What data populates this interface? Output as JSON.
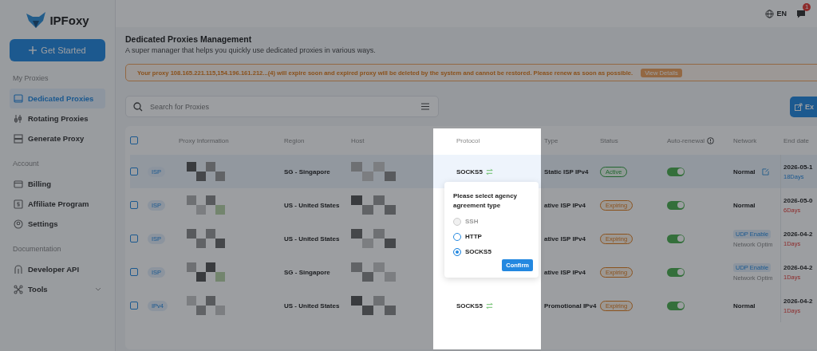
{
  "logo": {
    "name": "IPFoxy"
  },
  "sidebar": {
    "cta": "Get Started",
    "sections": [
      {
        "heading": "My Proxies",
        "items": [
          {
            "label": "Dedicated Proxies",
            "selected": true
          },
          {
            "label": "Rotating Proxies",
            "selected": false
          },
          {
            "label": "Generate Proxy",
            "selected": false
          }
        ]
      },
      {
        "heading": "Account",
        "items": [
          {
            "label": "Billing",
            "selected": false
          },
          {
            "label": "Affiliate Program",
            "selected": false
          },
          {
            "label": "Settings",
            "selected": false
          }
        ]
      },
      {
        "heading": "Documentation",
        "items": [
          {
            "label": "Developer API",
            "selected": false
          },
          {
            "label": "Tools",
            "selected": false,
            "expandable": true
          }
        ]
      }
    ]
  },
  "topbar": {
    "language": "EN",
    "notification_badge": "1"
  },
  "page": {
    "title": "Dedicated Proxies Management",
    "subtitle": "A super manager that helps you quickly use dedicated proxies in various ways."
  },
  "banner": {
    "message": "Your proxy 108.165.221.115,154.196.161.212...(4) will expire soon and expired proxy will be deleted by the system and cannot be restored. Please renew as soon as possible.",
    "action": "View Details"
  },
  "search": {
    "placeholder": "Search for Proxies"
  },
  "export_button": "Ex",
  "table": {
    "all_checked": false,
    "columns": [
      "Proxy Information",
      "Region",
      "Host",
      "Protocol",
      "Type",
      "Status",
      "Auto-renewal",
      "Network",
      "End date"
    ],
    "rows": [
      {
        "checked": false,
        "highlighted": true,
        "tag": "ISP",
        "region": "SG - Singapore",
        "protocol": "SOCKS5",
        "type": "Static ISP IPv4",
        "status": {
          "label": "Active",
          "kind": "active"
        },
        "auto_renewal": true,
        "network": {
          "kind": "normal",
          "label": "Normal"
        },
        "end_date": "2026-05-1",
        "days": "18Days",
        "urgent": false
      },
      {
        "checked": false,
        "highlighted": false,
        "tag": "ISP",
        "region": "US - United States",
        "type": "ative ISP IPv4",
        "status": {
          "label": "Expiring",
          "kind": "expiring"
        },
        "auto_renewal": true,
        "network": {
          "kind": "plain",
          "label": "Normal"
        },
        "end_date": "2026-05-0",
        "days": "6Days",
        "urgent": true
      },
      {
        "checked": false,
        "highlighted": false,
        "tag": "ISP",
        "region": "US - United States",
        "type": "ative ISP IPv4",
        "status": {
          "label": "Expiring",
          "kind": "expiring"
        },
        "auto_renewal": true,
        "network": {
          "kind": "udp",
          "label": "UDP Enable",
          "note": "Network Optim"
        },
        "end_date": "2026-04-2",
        "days": "1Days",
        "urgent": true
      },
      {
        "checked": false,
        "highlighted": false,
        "tag": "ISP",
        "region": "SG - Singapore",
        "type": "ative ISP IPv4",
        "status": {
          "label": "Expiring",
          "kind": "expiring"
        },
        "auto_renewal": true,
        "network": {
          "kind": "udp",
          "label": "UDP Enable",
          "note": "Network Optim"
        },
        "end_date": "2026-04-2",
        "days": "1Days",
        "urgent": true
      },
      {
        "checked": false,
        "highlighted": false,
        "tag": "IPv4",
        "region": "US - United States",
        "protocol": "SOCKS5",
        "type": "Promotional IPv4",
        "status": {
          "label": "Expiring",
          "kind": "expiring"
        },
        "auto_renewal": true,
        "network": {
          "kind": "plain",
          "label": "Normal"
        },
        "end_date": "2026-04-2",
        "days": "1Days",
        "urgent": true
      }
    ]
  },
  "popover": {
    "title": "Please select agency agreement type",
    "options": [
      {
        "label": "SSH",
        "disabled": true,
        "selected": false
      },
      {
        "label": "HTTP",
        "disabled": false,
        "selected": false
      },
      {
        "label": "SOCKS5",
        "disabled": false,
        "selected": true
      }
    ],
    "confirm": "Confirm"
  }
}
